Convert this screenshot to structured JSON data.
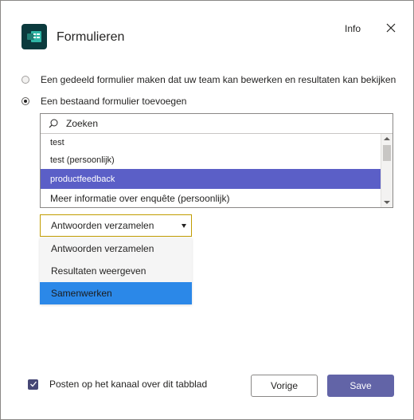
{
  "header": {
    "app_icon": "forms-app-icon",
    "title": "Formulieren",
    "info_label": "Info",
    "close_icon": "close-icon"
  },
  "options": [
    {
      "label": "Een gedeeld formulier maken dat uw team kan bewerken en resultaten kan bekijken",
      "checked": false
    },
    {
      "label": "Een bestaand formulier toevoegen",
      "checked": true
    }
  ],
  "search": {
    "placeholder": "Zoeken",
    "icon": "search-icon"
  },
  "form_list": {
    "items": [
      {
        "label": "test",
        "selected": false
      },
      {
        "label": "test (persoonlijk)",
        "selected": false
      },
      {
        "label": "productfeedback",
        "selected": true
      },
      {
        "label": "Meer informatie over enquête (persoonlijk)",
        "selected": false
      }
    ]
  },
  "action_dropdown": {
    "selected": "Antwoorden verzamelen",
    "options": [
      {
        "label": "Antwoorden verzamelen"
      },
      {
        "label": "Resultaten weergeven"
      },
      {
        "label": "Samenwerken"
      }
    ]
  },
  "footer": {
    "post_checkbox_label": "Posten op het kanaal over dit tabblad",
    "post_checked": true,
    "back_label": "Vorige",
    "save_label": "Save"
  },
  "colors": {
    "accent": "#6264a7",
    "selected_row": "#5b5fc7",
    "menu_highlight": "#2b88e8",
    "dropdown_border": "#c19c00"
  }
}
